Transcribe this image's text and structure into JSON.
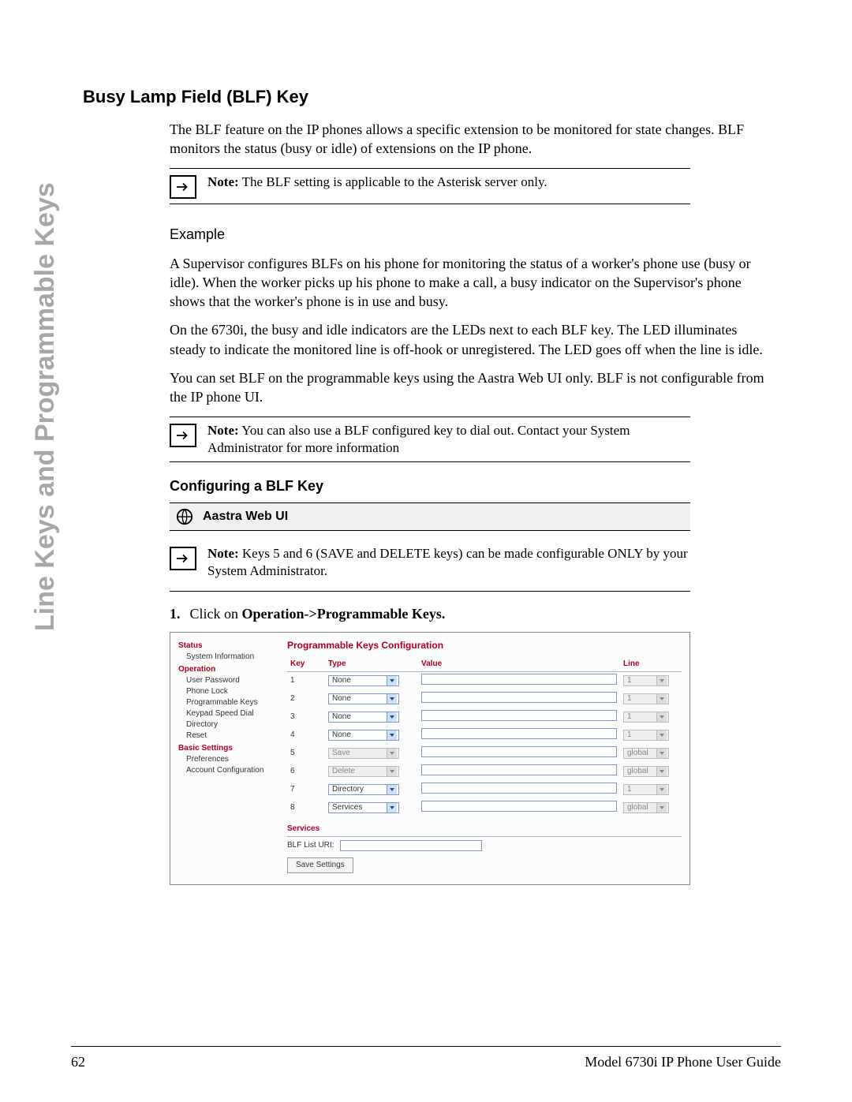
{
  "side_label": "Line Keys and Programmable Keys",
  "h1": "Busy Lamp Field (BLF) Key",
  "intro": "The BLF feature on the IP phones allows a specific extension to be monitored for state changes. BLF monitors the status (busy or idle) of extensions on the IP phone.",
  "note1_label": "Note:",
  "note1_text": " The BLF setting is applicable to the Asterisk server only.",
  "example_heading": "Example",
  "p1": "A Supervisor configures BLFs on his phone for monitoring the status of a worker's phone use (busy or idle). When the worker picks up his phone to make a call, a busy indicator on the Supervisor's phone shows that the worker's phone is in use and busy.",
  "p2": "On the 6730i, the busy and idle indicators are the LEDs next to each BLF key. The LED illuminates steady to indicate the monitored line is off-hook or unregistered. The LED goes off when the line is idle.",
  "p3": "You can set BLF on the programmable keys using the Aastra Web UI only. BLF is not configurable from the IP phone UI.",
  "note2_label": "Note:",
  "note2_text": " You can also use a BLF configured key to dial out. Contact your System Administrator for more information",
  "h2": "Configuring a BLF Key",
  "web_ui_label": "Aastra Web UI",
  "note3_label": "Note:",
  "note3_text": " Keys 5 and 6 (SAVE and DELETE keys) can be made configurable ONLY by your System Administrator.",
  "step1_num": "1.",
  "step1_prefix": "Click on ",
  "step1_bold": "Operation->Programmable Keys.",
  "webui": {
    "nav": {
      "groups": [
        {
          "label": "Status",
          "items": [
            "System Information"
          ]
        },
        {
          "label": "Operation",
          "items": [
            "User Password",
            "Phone Lock",
            "Programmable Keys",
            "Keypad Speed Dial",
            "Directory",
            "Reset"
          ]
        },
        {
          "label": "Basic Settings",
          "items": [
            "Preferences",
            "Account Configuration"
          ]
        }
      ]
    },
    "title": "Programmable Keys Configuration",
    "columns": {
      "key": "Key",
      "type": "Type",
      "value": "Value",
      "line": "Line"
    },
    "rows": [
      {
        "key": "1",
        "type": "None",
        "line": "1",
        "type_disabled": false,
        "line_disabled": true
      },
      {
        "key": "2",
        "type": "None",
        "line": "1",
        "type_disabled": false,
        "line_disabled": true
      },
      {
        "key": "3",
        "type": "None",
        "line": "1",
        "type_disabled": false,
        "line_disabled": true
      },
      {
        "key": "4",
        "type": "None",
        "line": "1",
        "type_disabled": false,
        "line_disabled": true
      },
      {
        "key": "5",
        "type": "Save",
        "line": "global",
        "type_disabled": true,
        "line_disabled": true
      },
      {
        "key": "6",
        "type": "Delete",
        "line": "global",
        "type_disabled": true,
        "line_disabled": true
      },
      {
        "key": "7",
        "type": "Directory",
        "line": "1",
        "type_disabled": false,
        "line_disabled": true
      },
      {
        "key": "8",
        "type": "Services",
        "line": "global",
        "type_disabled": false,
        "line_disabled": true
      }
    ],
    "services_heading": "Services",
    "blf_list_label": "BLF List URI:",
    "save_button": "Save Settings"
  },
  "footer": {
    "page": "62",
    "guide": "Model 6730i IP Phone User Guide"
  }
}
